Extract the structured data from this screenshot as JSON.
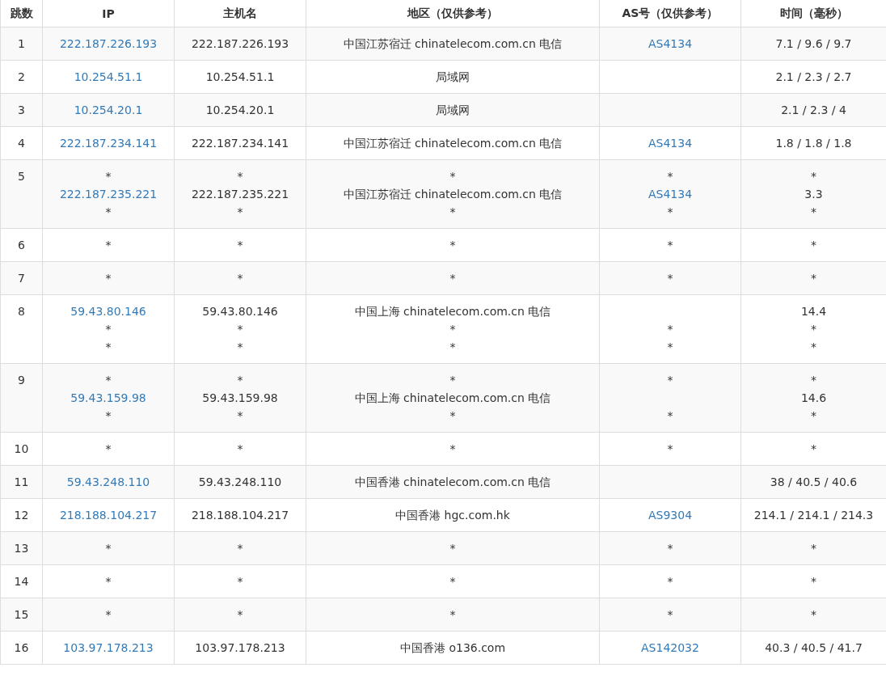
{
  "table": {
    "columns": [
      "跳数",
      "IP",
      "主机名",
      "地区（仅供参考）",
      "AS号（仅供参考）",
      "时间（毫秒）"
    ],
    "rows": [
      {
        "hop": "1",
        "ip": [
          {
            "text": "222.187.226.193",
            "kind": "link"
          }
        ],
        "host": [
          "222.187.226.193"
        ],
        "region": [
          "中国江苏宿迁 chinatelecom.com.cn 电信"
        ],
        "asn": [
          {
            "text": "AS4134",
            "kind": "link"
          }
        ],
        "time": [
          "7.1 / 9.6 / 9.7"
        ]
      },
      {
        "hop": "2",
        "ip": [
          {
            "text": "10.254.51.1",
            "kind": "link"
          }
        ],
        "host": [
          "10.254.51.1"
        ],
        "region": [
          "局域网"
        ],
        "asn": [],
        "time": [
          "2.1 / 2.3 / 2.7"
        ]
      },
      {
        "hop": "3",
        "ip": [
          {
            "text": "10.254.20.1",
            "kind": "link"
          }
        ],
        "host": [
          "10.254.20.1"
        ],
        "region": [
          "局域网"
        ],
        "asn": [],
        "time": [
          "2.1 / 2.3 / 4"
        ]
      },
      {
        "hop": "4",
        "ip": [
          {
            "text": "222.187.234.141",
            "kind": "link"
          }
        ],
        "host": [
          "222.187.234.141"
        ],
        "region": [
          "中国江苏宿迁 chinatelecom.com.cn 电信"
        ],
        "asn": [
          {
            "text": "AS4134",
            "kind": "link"
          }
        ],
        "time": [
          "1.8 / 1.8 / 1.8"
        ]
      },
      {
        "hop": "5",
        "ip": [
          {
            "text": "*",
            "kind": "plain"
          },
          {
            "text": "222.187.235.221",
            "kind": "link"
          },
          {
            "text": "*",
            "kind": "plain"
          }
        ],
        "host": [
          "*",
          "222.187.235.221",
          "*"
        ],
        "region": [
          "*",
          "中国江苏宿迁 chinatelecom.com.cn 电信",
          "*"
        ],
        "asn": [
          {
            "text": "*",
            "kind": "plain"
          },
          {
            "text": "AS4134",
            "kind": "link"
          },
          {
            "text": "*",
            "kind": "plain"
          }
        ],
        "time": [
          "*",
          "3.3",
          "*"
        ]
      },
      {
        "hop": "6",
        "ip": [
          {
            "text": "*",
            "kind": "plain"
          }
        ],
        "host": [
          "*"
        ],
        "region": [
          "*"
        ],
        "asn": [
          {
            "text": "*",
            "kind": "plain"
          }
        ],
        "time": [
          "*"
        ]
      },
      {
        "hop": "7",
        "ip": [
          {
            "text": "*",
            "kind": "plain"
          }
        ],
        "host": [
          "*"
        ],
        "region": [
          "*"
        ],
        "asn": [
          {
            "text": "*",
            "kind": "plain"
          }
        ],
        "time": [
          "*"
        ]
      },
      {
        "hop": "8",
        "ip": [
          {
            "text": "59.43.80.146",
            "kind": "link"
          },
          {
            "text": "*",
            "kind": "plain"
          },
          {
            "text": "*",
            "kind": "plain"
          }
        ],
        "host": [
          "59.43.80.146",
          "*",
          "*"
        ],
        "region": [
          "中国上海 chinatelecom.com.cn 电信",
          "*",
          "*"
        ],
        "asn": [
          {
            "kind": "blank"
          },
          {
            "text": "*",
            "kind": "plain"
          },
          {
            "text": "*",
            "kind": "plain"
          }
        ],
        "time": [
          "14.4",
          "*",
          "*"
        ]
      },
      {
        "hop": "9",
        "ip": [
          {
            "text": "*",
            "kind": "plain"
          },
          {
            "text": "59.43.159.98",
            "kind": "link"
          },
          {
            "text": "*",
            "kind": "plain"
          }
        ],
        "host": [
          "*",
          "59.43.159.98",
          "*"
        ],
        "region": [
          "*",
          "中国上海 chinatelecom.com.cn 电信",
          "*"
        ],
        "asn": [
          {
            "text": "*",
            "kind": "plain"
          },
          {
            "kind": "blank"
          },
          {
            "text": "*",
            "kind": "plain"
          }
        ],
        "time": [
          "*",
          "14.6",
          "*"
        ]
      },
      {
        "hop": "10",
        "ip": [
          {
            "text": "*",
            "kind": "plain"
          }
        ],
        "host": [
          "*"
        ],
        "region": [
          "*"
        ],
        "asn": [
          {
            "text": "*",
            "kind": "plain"
          }
        ],
        "time": [
          "*"
        ]
      },
      {
        "hop": "11",
        "ip": [
          {
            "text": "59.43.248.110",
            "kind": "link"
          }
        ],
        "host": [
          "59.43.248.110"
        ],
        "region": [
          "中国香港 chinatelecom.com.cn 电信"
        ],
        "asn": [],
        "time": [
          "38 / 40.5 / 40.6"
        ]
      },
      {
        "hop": "12",
        "ip": [
          {
            "text": "218.188.104.217",
            "kind": "link"
          }
        ],
        "host": [
          "218.188.104.217"
        ],
        "region": [
          "中国香港 hgc.com.hk"
        ],
        "asn": [
          {
            "text": "AS9304",
            "kind": "link"
          }
        ],
        "time": [
          "214.1 / 214.1 / 214.3"
        ]
      },
      {
        "hop": "13",
        "ip": [
          {
            "text": "*",
            "kind": "plain"
          }
        ],
        "host": [
          "*"
        ],
        "region": [
          "*"
        ],
        "asn": [
          {
            "text": "*",
            "kind": "plain"
          }
        ],
        "time": [
          "*"
        ]
      },
      {
        "hop": "14",
        "ip": [
          {
            "text": "*",
            "kind": "plain"
          }
        ],
        "host": [
          "*"
        ],
        "region": [
          "*"
        ],
        "asn": [
          {
            "text": "*",
            "kind": "plain"
          }
        ],
        "time": [
          "*"
        ]
      },
      {
        "hop": "15",
        "ip": [
          {
            "text": "*",
            "kind": "plain"
          }
        ],
        "host": [
          "*"
        ],
        "region": [
          "*"
        ],
        "asn": [
          {
            "text": "*",
            "kind": "plain"
          }
        ],
        "time": [
          "*"
        ]
      },
      {
        "hop": "16",
        "ip": [
          {
            "text": "103.97.178.213",
            "kind": "link"
          }
        ],
        "host": [
          "103.97.178.213"
        ],
        "region": [
          "中国香港 o136.com"
        ],
        "asn": [
          {
            "text": "AS142032",
            "kind": "link"
          }
        ],
        "time": [
          "40.3 / 40.5 / 41.7"
        ]
      }
    ]
  }
}
